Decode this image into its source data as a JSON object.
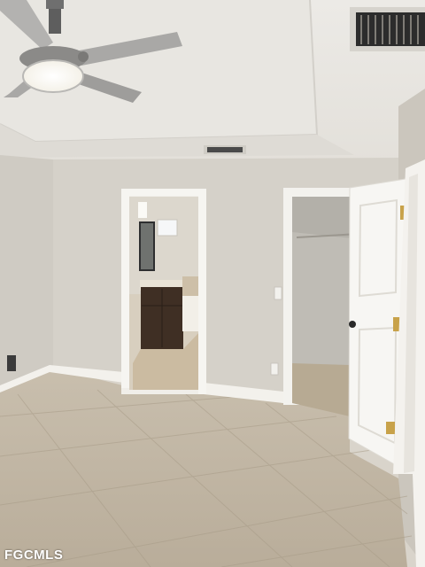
{
  "watermark": "FGCMLS"
}
